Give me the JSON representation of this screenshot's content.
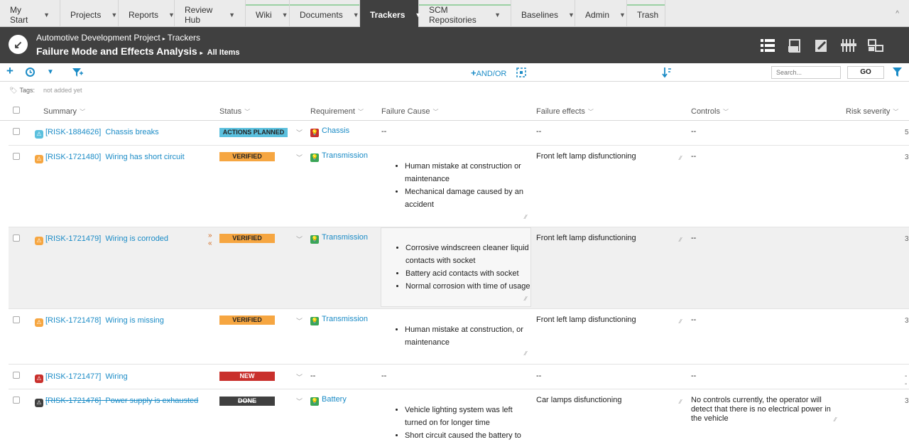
{
  "nav": {
    "tabs": [
      {
        "label": "My Start"
      },
      {
        "label": "Projects"
      },
      {
        "label": "Reports"
      },
      {
        "label": "Review Hub"
      },
      {
        "label": "Wiki"
      },
      {
        "label": "Documents"
      },
      {
        "label": "Trackers"
      },
      {
        "label": "SCM Repositories"
      },
      {
        "label": "Baselines"
      },
      {
        "label": "Admin"
      },
      {
        "label": "Trash"
      }
    ],
    "active": "Trackers",
    "dropdown_glyph": "▼",
    "collapse_glyph": "^"
  },
  "header": {
    "breadcrumb": [
      "Automotive Development Project",
      "Trackers"
    ],
    "title": "Failure Mode and Effects Analysis",
    "subtitle": "All Items",
    "view_icons": [
      "table-view-icon",
      "document-view-icon",
      "edit-view-icon",
      "board-view-icon",
      "tree-view-icon"
    ]
  },
  "toolbar": {
    "andor_label": "AND/OR",
    "search_placeholder": "Search...",
    "go_label": "GO"
  },
  "tags": {
    "label": "Tags:",
    "value": "not added yet"
  },
  "columns": {
    "summary": "Summary",
    "status": "Status",
    "requirement": "Requirement",
    "cause": "Failure Cause",
    "effects": "Failure effects",
    "controls": "Controls",
    "risk": "Risk severity"
  },
  "rows": [
    {
      "id": "[RISK-1884626]",
      "summary": "Chassis breaks",
      "status": "ACTIONS PLANNED",
      "requirement": "Chassis",
      "causes": [],
      "cause_text": "--",
      "effects": "--",
      "controls": "--",
      "risk": "5"
    },
    {
      "id": "[RISK-1721480]",
      "summary": "Wiring has short circuit",
      "status": "VERIFIED",
      "requirement": "Transmission",
      "causes": [
        "Human mistake at construction or maintenance",
        "Mechanical damage caused by an accident"
      ],
      "effects": "Front left lamp disfunctioning",
      "controls": "--",
      "risk": "3"
    },
    {
      "id": "[RISK-1721479]",
      "summary": "Wiring is corroded",
      "status": "VERIFIED",
      "requirement": "Transmission",
      "causes": [
        "Corrosive windscreen cleaner liquid contacts with socket",
        "Battery acid contacts with socket",
        "Normal corrosion with time of usage"
      ],
      "effects": "Front left lamp disfunctioning",
      "controls": "--",
      "risk": "3"
    },
    {
      "id": "[RISK-1721478]",
      "summary": "Wiring is missing",
      "status": "VERIFIED",
      "requirement": "Transmission",
      "causes": [
        "Human mistake at construction, or maintenance"
      ],
      "effects": "Front left lamp disfunctioning",
      "controls": "--",
      "risk": "3"
    },
    {
      "id": "[RISK-1721477]",
      "summary": "Wiring",
      "status": "NEW",
      "requirement": "--",
      "causes": [],
      "cause_text": "--",
      "effects": "--",
      "controls": "--",
      "risk": "--"
    },
    {
      "id": "[RISK-1721476]",
      "summary": "Power supply is exhausted",
      "status": "DONE",
      "requirement": "Battery",
      "causes": [
        "Vehicle lighting system was left turned on for longer time",
        "Short circuit caused the battery to"
      ],
      "effects": "Car lamps disfunctioning",
      "controls": "No controls currently, the operator will detect that there is no electrical power in the vehicle",
      "risk": "3"
    }
  ],
  "colors": {
    "accent": "#1a8bc6",
    "header_bg": "#404040",
    "actions_planned": "#5bc0de",
    "verified": "#f6a641",
    "new": "#c9302c",
    "done": "#404040"
  }
}
